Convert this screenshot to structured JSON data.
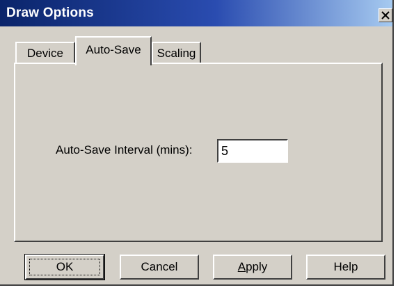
{
  "window": {
    "title": "Draw Options",
    "close_icon": "close-icon"
  },
  "tabs": [
    {
      "label": "Device",
      "selected": false
    },
    {
      "label": "Auto-Save",
      "selected": true
    },
    {
      "label": "Scaling",
      "selected": false
    }
  ],
  "autosave": {
    "interval_label": "Auto-Save Interval (mins):",
    "interval_value": "5"
  },
  "buttons": {
    "ok": "OK",
    "cancel": "Cancel",
    "apply_mnemonic": "A",
    "apply_rest": "pply",
    "help": "Help"
  },
  "colors": {
    "title_bar_start": "#0a246a",
    "title_bar_end": "#a6caf0",
    "face": "#d4d0c8"
  }
}
